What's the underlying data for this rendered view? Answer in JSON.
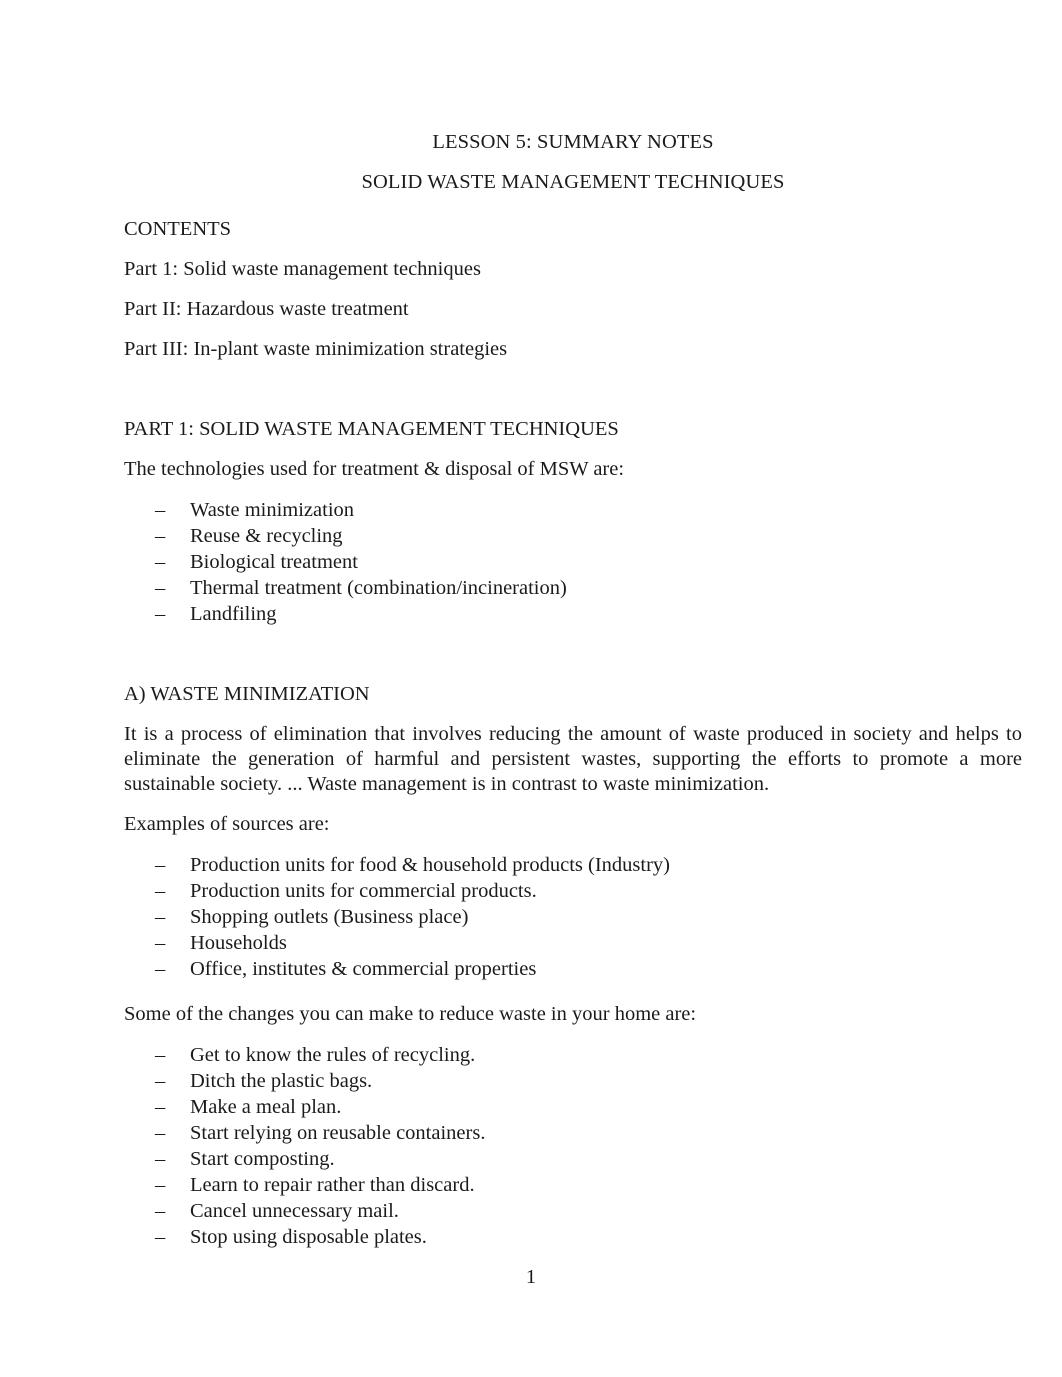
{
  "document": {
    "titles": [
      "LESSON 5: SUMMARY NOTES",
      "SOLID WASTE MANAGEMENT TECHNIQUES"
    ],
    "contents_heading": "CONTENTS",
    "contents_items": [
      "Part 1: Solid waste management techniques",
      "Part II: Hazardous waste treatment",
      "Part III: In-plant waste minimization strategies"
    ],
    "part1_heading": "PART 1: SOLID WASTE MANAGEMENT TECHNIQUES",
    "technologies_intro": "The technologies used for treatment & disposal of MSW are:",
    "technologies": [
      "Waste minimization",
      "Reuse & recycling",
      "Biological treatment",
      "Thermal treatment (combination/incineration)",
      "Landfiling"
    ],
    "section_a_heading": "A) WASTE MINIMIZATION",
    "section_a_paragraph": "It is a process of elimination that involves reducing the amount of waste produced in society and helps to eliminate the generation of harmful and persistent wastes, supporting the efforts to promote a more sustainable society. ... Waste management is in contrast to waste minimization.",
    "sources_intro": "Examples of sources are:",
    "sources": [
      "Production units for food & household products (Industry)",
      "Production units for commercial products.",
      "Shopping outlets (Business place)",
      "Households",
      "Office, institutes & commercial properties"
    ],
    "changes_intro": "Some of the changes you can make to reduce waste in your home are:",
    "changes": [
      "Get to know the rules of recycling.",
      "Ditch the plastic bags.",
      "Make a meal plan.",
      "Start relying on reusable containers.",
      "Start composting.",
      "Learn to repair rather than discard.",
      "Cancel unnecessary mail.",
      "Stop using disposable plates."
    ],
    "bullet_marker": "–",
    "page_number": "1"
  }
}
